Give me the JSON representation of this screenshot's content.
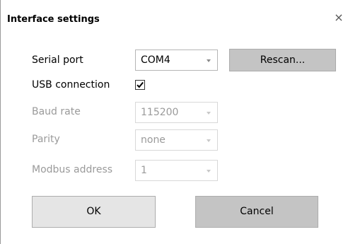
{
  "dialog": {
    "title": "Interface settings",
    "close_glyph": "×"
  },
  "form": {
    "serial_port": {
      "label": "Serial port",
      "value": "COM4",
      "rescan_label": "Rescan..."
    },
    "usb_connection": {
      "label": "USB connection",
      "checked": true
    },
    "baud_rate": {
      "label": "Baud rate",
      "value": "115200",
      "enabled": false
    },
    "parity": {
      "label": "Parity",
      "value": "none",
      "enabled": false
    },
    "modbus_address": {
      "label": "Modbus address",
      "value": "1",
      "enabled": false
    }
  },
  "buttons": {
    "ok_label": "OK",
    "cancel_label": "Cancel"
  },
  "icons": {
    "close": "close-icon",
    "dropdown": "chevron-down-icon",
    "check": "check-icon"
  }
}
